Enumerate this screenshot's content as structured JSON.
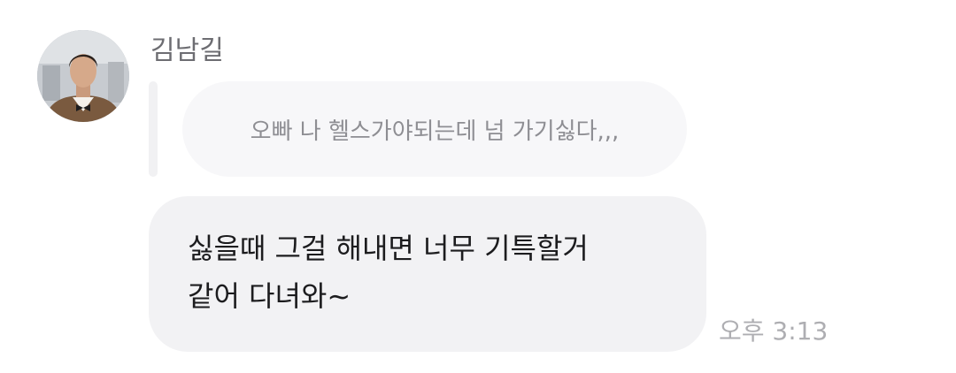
{
  "message": {
    "sender": {
      "name": "김남길",
      "avatar_icon": "profile-photo"
    },
    "reply": {
      "quoted_text": "오빠 나 헬스가야되는데 넘 가기싫다,,,"
    },
    "body": {
      "lines": [
        "싫을때 그걸 해내면 너무 기특할거",
        "같어 다녀와~"
      ]
    },
    "time": "오후 3:13"
  },
  "colors": {
    "bubble_background": "#f2f2f4",
    "quoted_background": "#f7f7f9",
    "primary_text": "#1c1c1e",
    "secondary_text": "#8e8e93"
  }
}
